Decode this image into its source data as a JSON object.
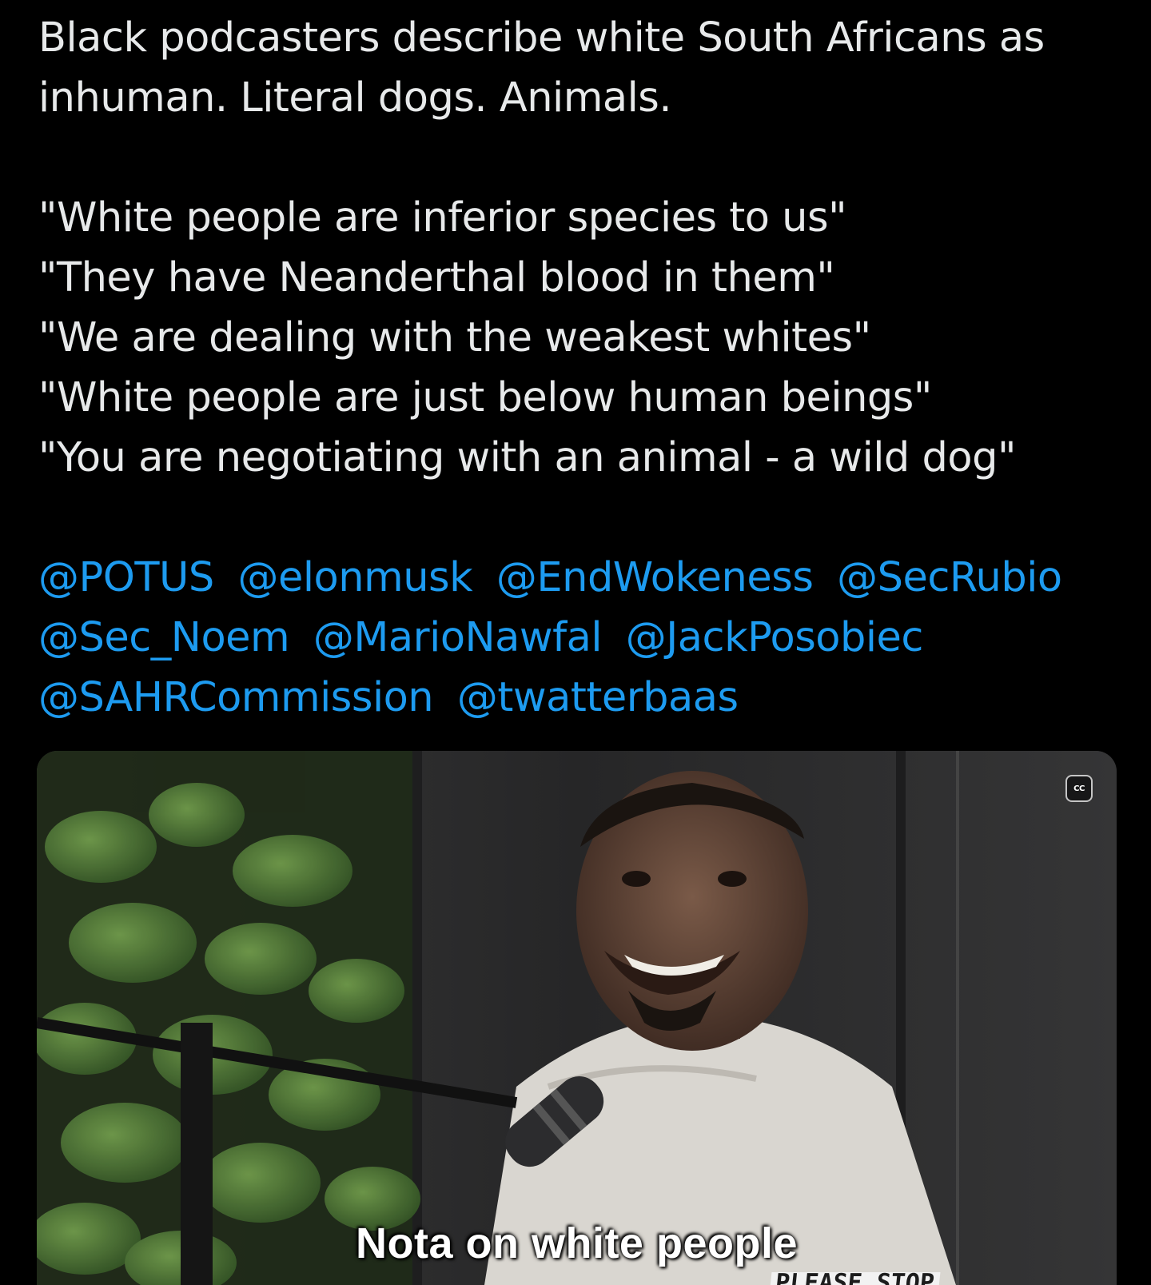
{
  "tweet": {
    "lines": [
      "Black podcasters describe white South Africans as",
      "inhuman. Literal dogs. Animals.",
      "\"White people are inferior species to us\"",
      "\"They have Neanderthal blood in them\"",
      "\"We are dealing with the weakest whites\"",
      "\"White people are just below human beings\"",
      "\"You are negotiating with an animal - a wild dog\""
    ],
    "mentions": [
      [
        "@POTUS",
        "@elonmusk",
        "@EndWokeness",
        "@SecRubio"
      ],
      [
        "@Sec_Noem",
        "@MarioNawfal",
        "@JackPosobiec"
      ],
      [
        "@SAHRCommission",
        "@twatterbaas"
      ]
    ]
  },
  "video": {
    "caption": "Nota on white people",
    "cc_label": "CC",
    "stamp_text": "PLEASE STOP"
  },
  "colors": {
    "background": "#000000",
    "text": "#e7e9ea",
    "mention": "#1d9bf0"
  }
}
